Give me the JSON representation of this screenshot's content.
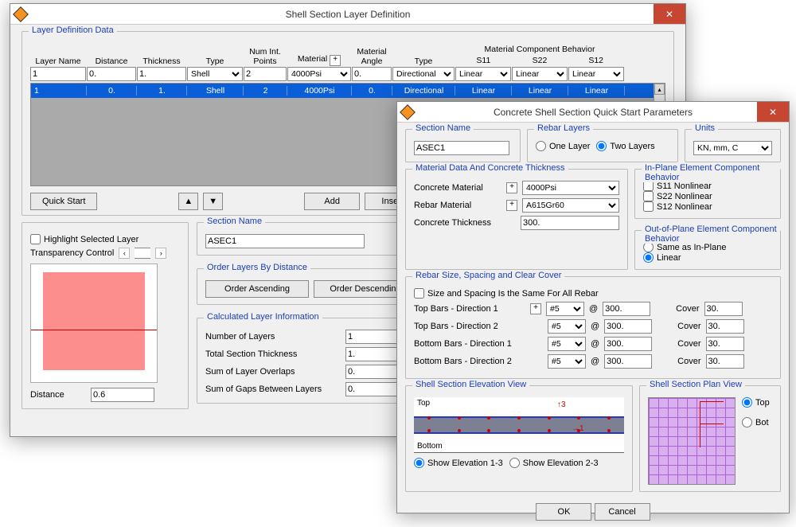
{
  "win1": {
    "title": "Shell Section Layer Definition",
    "group1": "Layer Definition Data",
    "hdr": {
      "layer": "Layer Name",
      "distance": "Distance",
      "thickness": "Thickness",
      "type": "Type",
      "numint": "Num Int.\nPoints",
      "material": "Material",
      "matangle": "Material\nAngle",
      "type2": "Type",
      "s11": "Material   Component   Behavior",
      "s11b": "S11",
      "s22": "S22",
      "s12": "S12"
    },
    "input_row": {
      "layer": "1",
      "distance": "0.",
      "thickness": "1.",
      "type": "Shell",
      "numint": "2",
      "material": "4000Psi",
      "angle": "0.",
      "type2": "Directional",
      "s11": "Linear",
      "s22": "Linear",
      "s12": "Linear"
    },
    "sel_row": {
      "layer": "1",
      "distance": "0.",
      "thickness": "1.",
      "type": "Shell",
      "numint": "2",
      "material": "4000Psi",
      "angle": "0.",
      "type2": "Directional",
      "s11": "Linear",
      "s22": "Linear",
      "s12": "Linear"
    },
    "quick": "Quick Start",
    "add": "Add",
    "insert": "Insert",
    "highlight": "Highlight Selected Layer",
    "transp": "Transparency Control",
    "distance_lbl": "Distance",
    "distance_val": "0.6",
    "secname_g": "Section Name",
    "secname": "ASEC1",
    "order_g": "Order Layers By Distance",
    "asc": "Order Ascending",
    "desc": "Order Descending",
    "calc_g": "Calculated Layer Information",
    "calc": {
      "n": "Number of Layers",
      "nv": "1",
      "t": "Total Section Thickness",
      "tv": "1.",
      "o": "Sum of Layer Overlaps",
      "ov": "0.",
      "g": "Sum of Gaps Between Layers",
      "gv": "0."
    }
  },
  "win2": {
    "title": "Concrete Shell Section Quick Start Parameters",
    "sec_g": "Section Name",
    "sec": "ASEC1",
    "rebar_g": "Rebar Layers",
    "one": "One Layer",
    "two": "Two Layers",
    "units_g": "Units",
    "units": "KN, mm, C",
    "mat_g": "Material Data And Concrete Thickness",
    "conc_lbl": "Concrete Material",
    "conc": "4000Psi",
    "reb_lbl": "Rebar Material",
    "reb": "A615Gr60",
    "thk_lbl": "Concrete Thickness",
    "thk": "300.",
    "inplane_g": "In-Plane Element Component Behavior",
    "s11n": "S11 Nonlinear",
    "s22n": "S22 Nonlinear",
    "s12n": "S12 Nonlinear",
    "outplane_g": "Out-of-Plane Element Component Behavior",
    "same": "Same as In-Plane",
    "linear": "Linear",
    "rsize_g": "Rebar Size, Spacing and Clear Cover",
    "samecb": "Size and Spacing Is the Same For All Rebar",
    "rows": [
      {
        "lbl": "Top Bars  -  Direction 1",
        "plus": true,
        "size": "#5",
        "at": "@",
        "sp": "300.",
        "cov_lbl": "Cover",
        "cov": "30."
      },
      {
        "lbl": "Top Bars  -  Direction 2",
        "plus": false,
        "size": "#5",
        "at": "@",
        "sp": "300.",
        "cov_lbl": "Cover",
        "cov": "30."
      },
      {
        "lbl": "Bottom Bars  -  Direction 1",
        "plus": false,
        "size": "#5",
        "at": "@",
        "sp": "300.",
        "cov_lbl": "Cover",
        "cov": "30."
      },
      {
        "lbl": "Bottom Bars  -  Direction 2",
        "plus": false,
        "size": "#5",
        "at": "@",
        "sp": "300.",
        "cov_lbl": "Cover",
        "cov": "30."
      }
    ],
    "elev_g": "Shell Section Elevation View",
    "top": "Top",
    "bottom": "Bottom",
    "e13": "Show Elevation 1-3",
    "e23": "Show Elevation 2-3",
    "plan_g": "Shell Section Plan View",
    "ptop": "Top",
    "pbot": "Bot",
    "ok": "OK",
    "cancel": "Cancel"
  }
}
